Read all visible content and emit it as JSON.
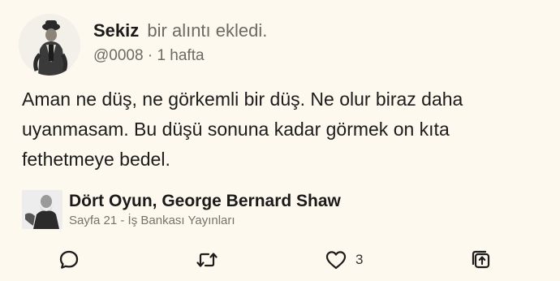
{
  "post": {
    "username": "Sekiz",
    "action_text": "bir alıntı ekledi.",
    "handle": "@0008",
    "separator": "·",
    "time": "1 hafta",
    "quote": "Aman ne düş, ne görkemli bir düş. Ne olur biraz daha uyanmasam. Bu düşü sonuna kadar görmek on kıta fethetmeye bedel."
  },
  "book": {
    "title": "Dört Oyun, George Bernard Shaw",
    "subtitle": "Sayfa 21 - İş Bankası Yayınları"
  },
  "actions": {
    "like_count": "3",
    "icons": [
      "comment-icon",
      "repost-icon",
      "heart-icon",
      "share-icon"
    ]
  },
  "colors": {
    "background": "#fdf9ee",
    "text": "#1a1a1a",
    "muted": "#6d6a63"
  }
}
